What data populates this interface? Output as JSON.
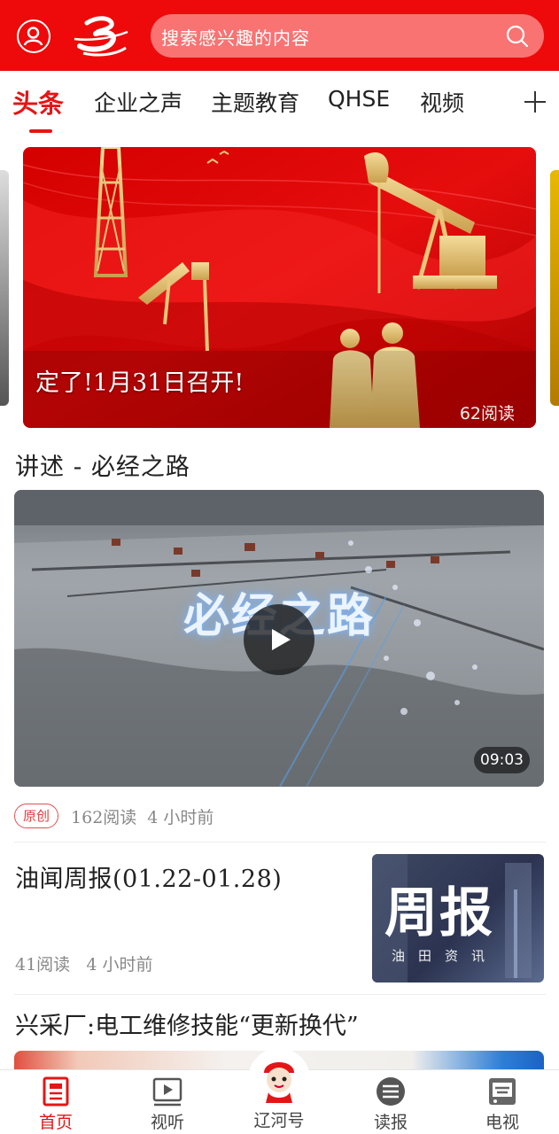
{
  "header": {
    "search_placeholder": "搜索感兴趣的内容",
    "accent_color": "#ee0a0a"
  },
  "tabs": [
    {
      "label": "头条",
      "active": true
    },
    {
      "label": "企业之声",
      "active": false
    },
    {
      "label": "主题教育",
      "active": false
    },
    {
      "label": "QHSE",
      "active": false
    },
    {
      "label": "视频",
      "active": false
    }
  ],
  "carousel": {
    "title": "定了!1月31日召开!",
    "reads": "62阅读"
  },
  "video_article": {
    "section_title": "讲述 - 必经之路",
    "headline_overlay": "必经之路",
    "duration": "09:03",
    "badge": "原创",
    "reads": "162阅读",
    "time": "4 小时前"
  },
  "weekly_article": {
    "title": "油闻周报(01.22-01.28)",
    "reads": "41阅读",
    "time": "4 小时前",
    "thumb_big": "周报",
    "thumb_small": "油田资讯"
  },
  "next_article": {
    "title": "兴采厂:电工维修技能“更新换代”"
  },
  "bottom_nav": [
    {
      "label": "首页",
      "icon": "home-news-icon",
      "active": true
    },
    {
      "label": "视听",
      "icon": "play-screen-icon",
      "active": false
    },
    {
      "label": "辽河号",
      "icon": "mascot-icon",
      "active": false
    },
    {
      "label": "读报",
      "icon": "newspaper-icon",
      "active": false
    },
    {
      "label": "电视",
      "icon": "tv-icon",
      "active": false
    }
  ]
}
